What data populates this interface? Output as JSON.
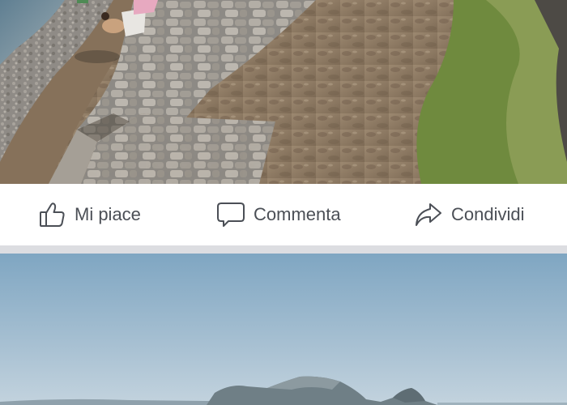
{
  "post_actions": {
    "like_label": "Mi piace",
    "comment_label": "Commenta",
    "share_label": "Condividi"
  },
  "icons": {
    "like": "thumbs-up-icon",
    "comment": "speech-bubble-icon",
    "share": "share-arrow-icon"
  },
  "colors": {
    "action_text": "#4b4f56",
    "feed_divider": "#dcdde1",
    "bar_background": "#ffffff"
  }
}
